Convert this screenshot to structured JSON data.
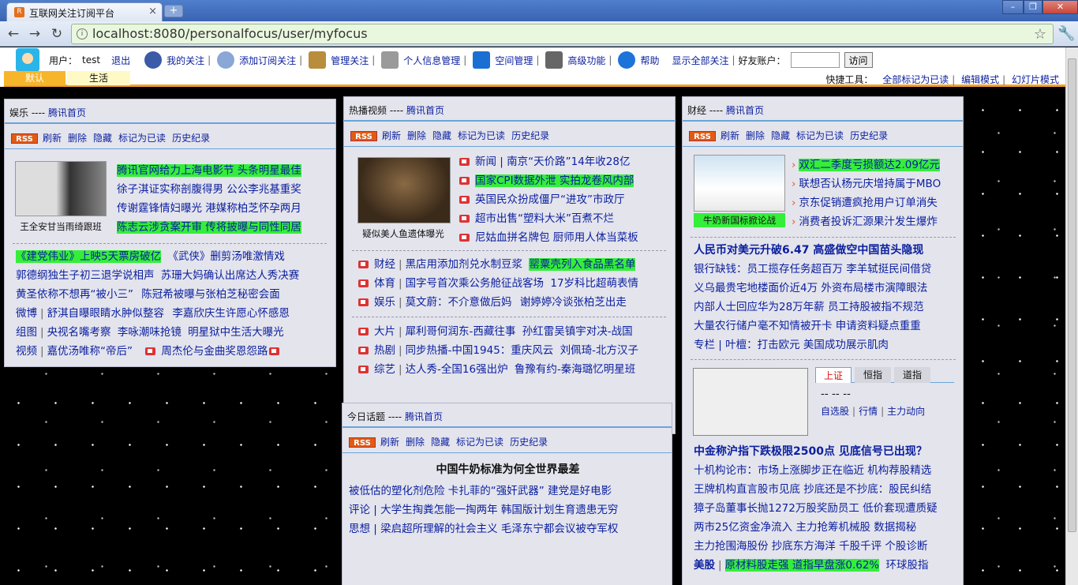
{
  "browser": {
    "tab_title": "互联网关注订阅平台",
    "url": "localhost:8080/personalfocus/user/myfocus"
  },
  "header": {
    "user_label": "用户：",
    "username": "test",
    "logout": "退出",
    "nav": [
      "我的关注",
      "添加订阅关注",
      "管理关注",
      "个人信息管理",
      "空间管理",
      "高级功能",
      "帮助",
      "显示全部关注"
    ],
    "friend_label": "好友账户：",
    "visit": "访问",
    "tabs": [
      "默认",
      "生活"
    ],
    "quick_label": "快捷工具：",
    "quick": [
      "全部标记为已读",
      "编辑模式",
      "幻灯片模式"
    ]
  },
  "ops": {
    "rss": "RSS",
    "refresh": "刷新",
    "delete": "删除",
    "hide": "隐藏",
    "mark": "标记为已读",
    "history": "历史纪录"
  },
  "boxes": {
    "ent": {
      "title": "娱乐 ---- ",
      "home": "腾讯首页",
      "caption": "王全安甘当雨绮跟班",
      "side": [
        "腾讯官网给力上海电影节 头条明星最佳",
        "徐子淇证实称剖腹得男 公公李兆基重奖",
        "传谢霆锋情妇曝光 港媒称柏芝怀孕两月",
        "陈志云涉贪案开审 传将披曝与同性同居"
      ],
      "lines": [
        [
          "《建党伟业》上映5天票房破亿",
          "《武侠》删剪汤唯激情戏"
        ],
        [
          "郭德纲独生子初三退学说相声",
          "苏珊大妈确认出席达人秀决赛"
        ],
        [
          "黄圣依称不想再“被小三”",
          "陈冠希被曝与张柏芝秘密会面"
        ],
        [
          "微博",
          "舒淇自曝眼睛水肿似整容",
          "李嘉欣庆生许愿心怀感恩"
        ],
        [
          "组图",
          "央视名嘴考察",
          "李咏潮味抢镜",
          "明星狱中生活大曝光"
        ],
        [
          "视频",
          "嘉优汤唯称“帝后”",
          "周杰伦与金曲奖恩怨路"
        ]
      ]
    },
    "video": {
      "title": "热播视频 ---- ",
      "home": "腾讯首页",
      "caption": "疑似美人鱼遗体曝光",
      "side": [
        "新闻 | 南京“天价路”14年收28亿",
        "国家CPI数据外泄 实拍龙卷风内部",
        "英国民众扮成僵尸“进攻”市政厅",
        "超市出售“塑料大米”百煮不烂",
        "尼姑血拼名牌包 厨师用人体当菜板"
      ],
      "cats": [
        [
          "财经",
          "黑店用添加剂兑水制豆浆",
          "罂粟壳列入食品黑名单"
        ],
        [
          "体育",
          "国字号首次乘公务舱征战客场",
          "17岁科比超萌表情"
        ],
        [
          "娱乐",
          "莫文蔚：不介意做后妈",
          "谢婷婷冷谈张柏芝出走"
        ],
        [
          "大片",
          "犀利哥何润东-西藏往事",
          "孙红雷吴镇宇对决-战国"
        ],
        [
          "热剧",
          "同步热播-中国1945：重庆风云",
          "刘佩琦-北方汉子"
        ],
        [
          "综艺",
          "达人秀-全国16强出炉",
          "鲁豫有约-秦海璐忆明星班"
        ]
      ]
    },
    "topic": {
      "title": "今日话题 ---- ",
      "home": "腾讯首页",
      "headline": "中国牛奶标准为何全世界最差",
      "lines": [
        "被低估的塑化剂危险 卡扎菲的“强奸武器” 建党是好电影",
        "评论 | 大学生掏粪怎能一掏两年 韩国版计划生育遗患无穷",
        "思想 | 梁启超所理解的社会主义 毛泽东宁都会议被夺军权"
      ]
    },
    "fin": {
      "title": "财经 ---- ",
      "home": "腾讯首页",
      "caption": "牛奶新国标掀论战",
      "side": [
        "双汇二季度亏损额达2.09亿元",
        "联想否认杨元庆增持属于MBO",
        "京东促销遭疯抢用户订单消失",
        "消费者投诉汇源果汁发生爆炸"
      ],
      "headline1": "人民币对美元升破6.47 高盛做空中国苗头隐现",
      "lines1": [
        "银行缺钱：员工揽存任务超百万 李羊轼挺民间借贷",
        "义乌最贵宅地楼面价近4万 外资布局楼市演障眼法",
        "内部人士回应华为28万年薪 员工持股被指不规范",
        "大量农行储户毫不知情被开卡 申请资料疑点重重",
        "专栏 | 叶檀：打击欧元 美国成功展示肌肉"
      ],
      "qtabs": [
        "上证",
        "恒指",
        "道指"
      ],
      "qval": "-- -- --",
      "qlinks": [
        "自选股",
        "行情",
        "主力动向"
      ],
      "headline2": "中金称沪指下跌极限2500点 见底信号已出现？",
      "lines2": [
        "十机构论市：市场上涨脚步正在临近 机构荐股精选",
        "王牌机构直言股市见底 抄底还是不抄底：股民纠结",
        "獐子岛董事长抛1272万股奖励员工 低价套现遭质疑",
        "两市25亿资金净流入 主力抢筹机械股 数据揭秘",
        "主力抢围海股份 抄底东方海洋 千股千评 个股诊断"
      ],
      "last": [
        "美股",
        "原材料股走强 道指早盘涨0.62%",
        "环球股指"
      ]
    }
  }
}
